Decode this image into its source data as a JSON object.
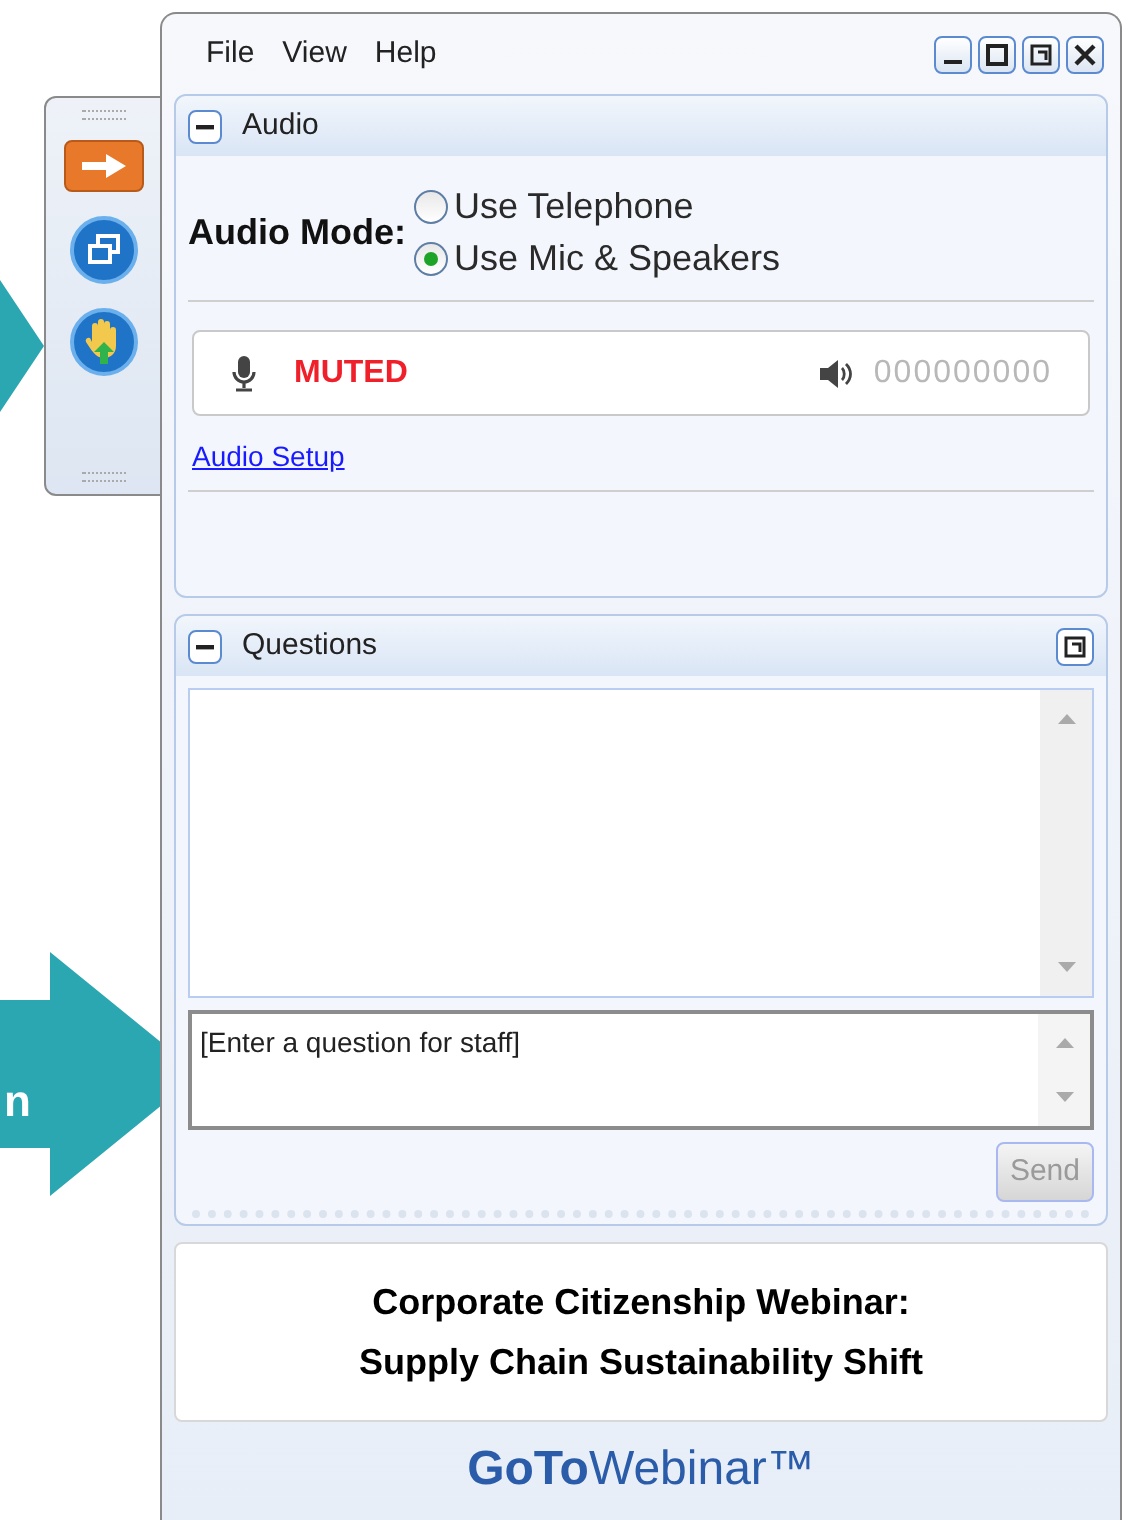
{
  "callout_text": "n",
  "menu": [
    "File",
    "View",
    "Help"
  ],
  "audio": {
    "title": "Audio",
    "expanded": true,
    "mode_label": "Audio Mode:",
    "options": [
      {
        "label": "Use Telephone",
        "selected": false
      },
      {
        "label": "Use Mic & Speakers",
        "selected": true
      }
    ],
    "mic_status": "MUTED",
    "speaker_reading": "000000000",
    "setup_link": "Audio Setup"
  },
  "questions": {
    "title": "Questions",
    "expanded": true,
    "placeholder": "[Enter a question for staff]",
    "send": {
      "label": "Send",
      "disabled": true
    }
  },
  "webinar_title": [
    "Corporate Citizenship Webinar:",
    "Supply Chain Sustainability Shift"
  ],
  "brand": "**GoTo**Webinar™"
}
